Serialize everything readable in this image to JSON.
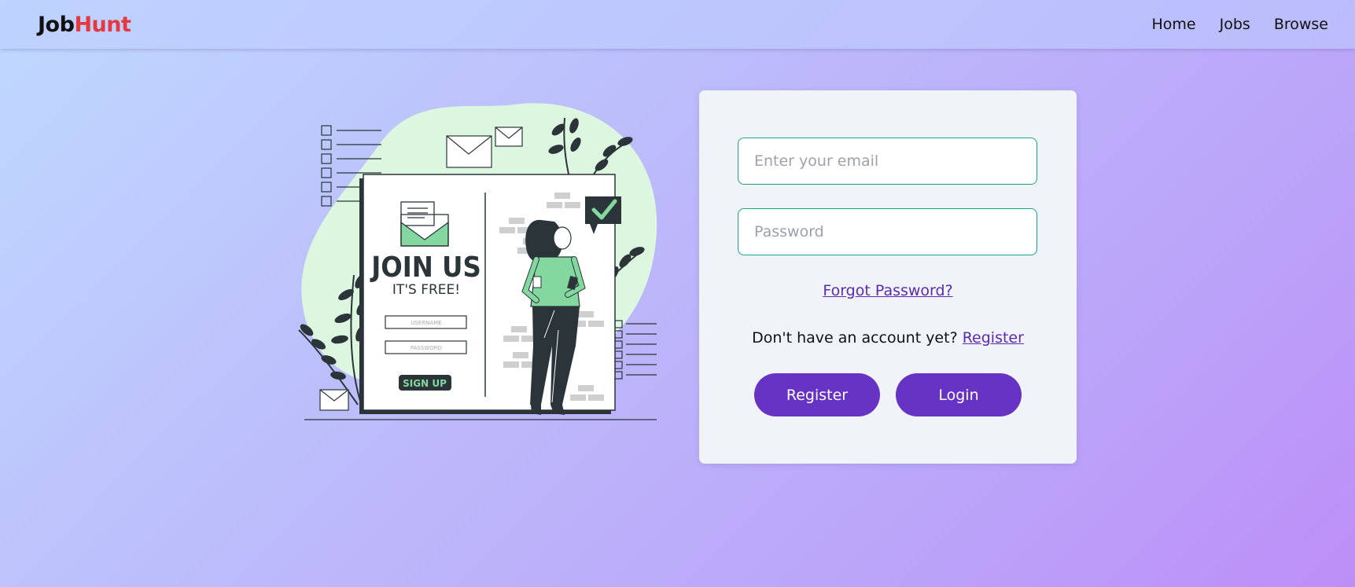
{
  "nav": {
    "logo_part1": "Job",
    "logo_part2": "Hunt",
    "links": [
      "Home",
      "Jobs",
      "Browse"
    ]
  },
  "illustration": {
    "heading": "JOIN US",
    "subheading": "IT'S FREE!",
    "username_label": "USERNAME",
    "password_label": "PASSWORD",
    "signup_label": "SIGN UP"
  },
  "login_form": {
    "email_placeholder": "Enter your email",
    "password_placeholder": "Password",
    "forgot_password": "Forgot Password?",
    "no_account_text": "Don't have an account yet? ",
    "register_link": "Register",
    "register_button": "Register",
    "login_button": "Login"
  },
  "colors": {
    "accent": "#6633c4",
    "field_border": "#17a589",
    "logo_red": "#e5393f",
    "card_bg": "#f0f3f8"
  }
}
